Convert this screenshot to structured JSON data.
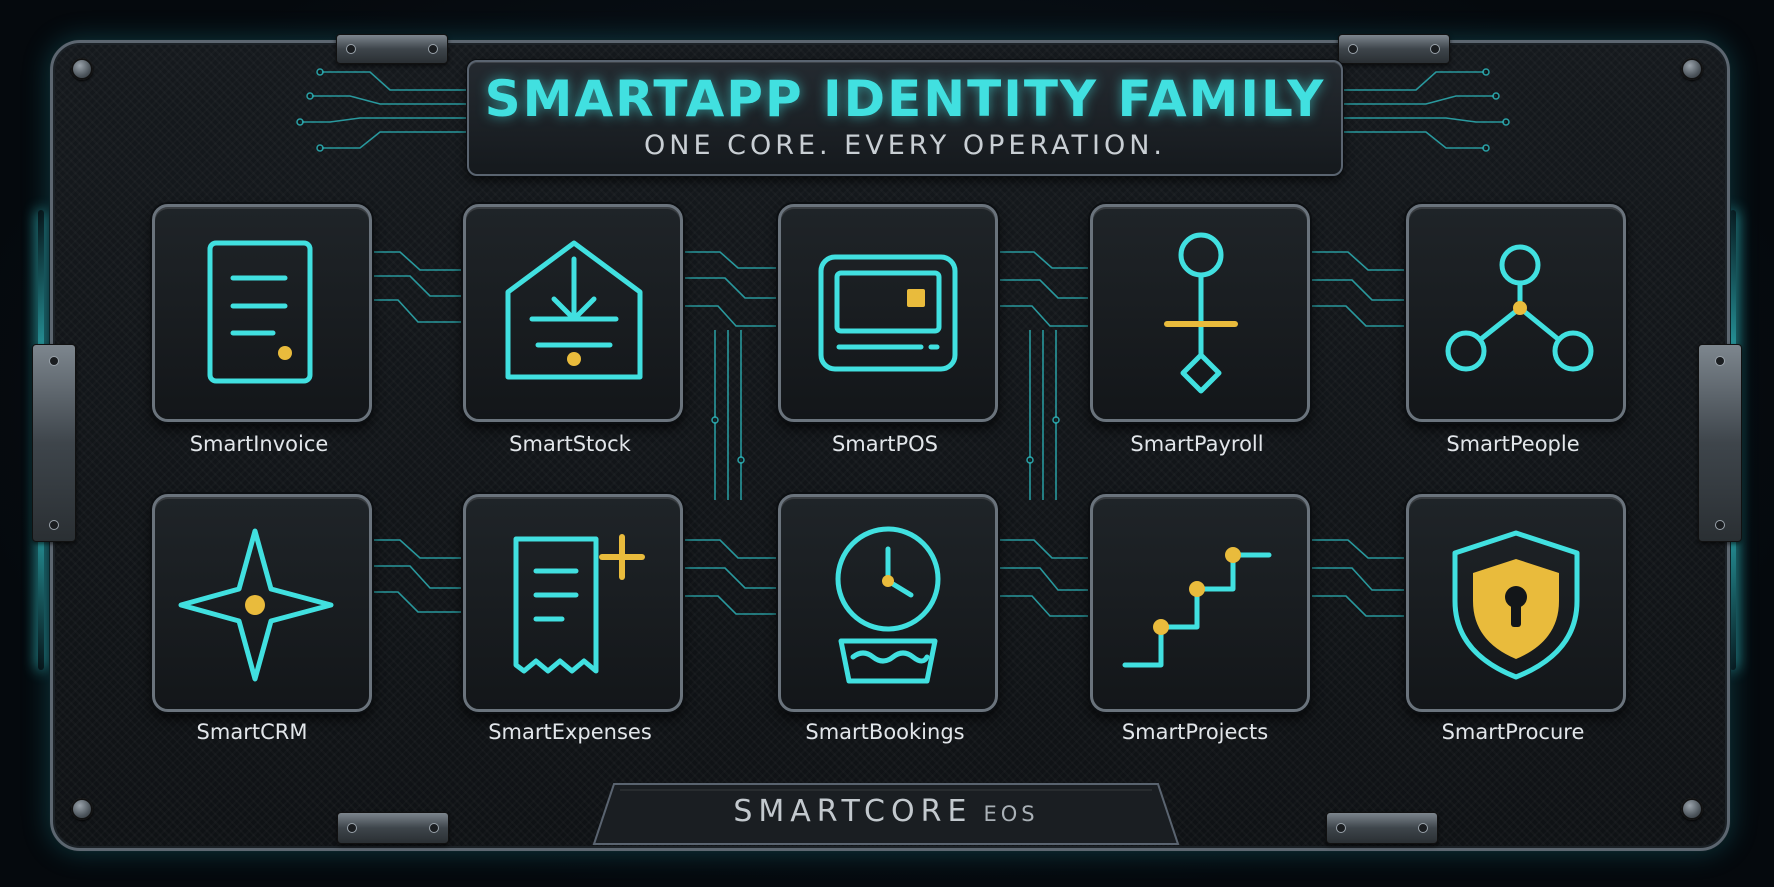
{
  "header": {
    "title": "SMARTAPP IDENTITY FAMILY",
    "subtitle": "ONE CORE. EVERY OPERATION."
  },
  "apps": [
    {
      "label": "SmartInvoice",
      "icon": "invoice-document-icon"
    },
    {
      "label": "SmartStock",
      "icon": "warehouse-inbound-icon"
    },
    {
      "label": "SmartPOS",
      "icon": "pos-terminal-icon"
    },
    {
      "label": "SmartPayroll",
      "icon": "payroll-balance-icon"
    },
    {
      "label": "SmartPeople",
      "icon": "people-network-icon"
    },
    {
      "label": "SmartCRM",
      "icon": "compass-star-icon"
    },
    {
      "label": "SmartExpenses",
      "icon": "receipt-plus-icon"
    },
    {
      "label": "SmartBookings",
      "icon": "clock-bowl-icon"
    },
    {
      "label": "SmartProjects",
      "icon": "stairs-progress-icon"
    },
    {
      "label": "SmartProcure",
      "icon": "shield-lock-icon"
    }
  ],
  "footer": {
    "main": "SMARTCORE",
    "sub": "EOS"
  },
  "colors": {
    "accent": "#41e0e0",
    "gold": "#e9bb3c",
    "text": "#e2e6ea"
  }
}
